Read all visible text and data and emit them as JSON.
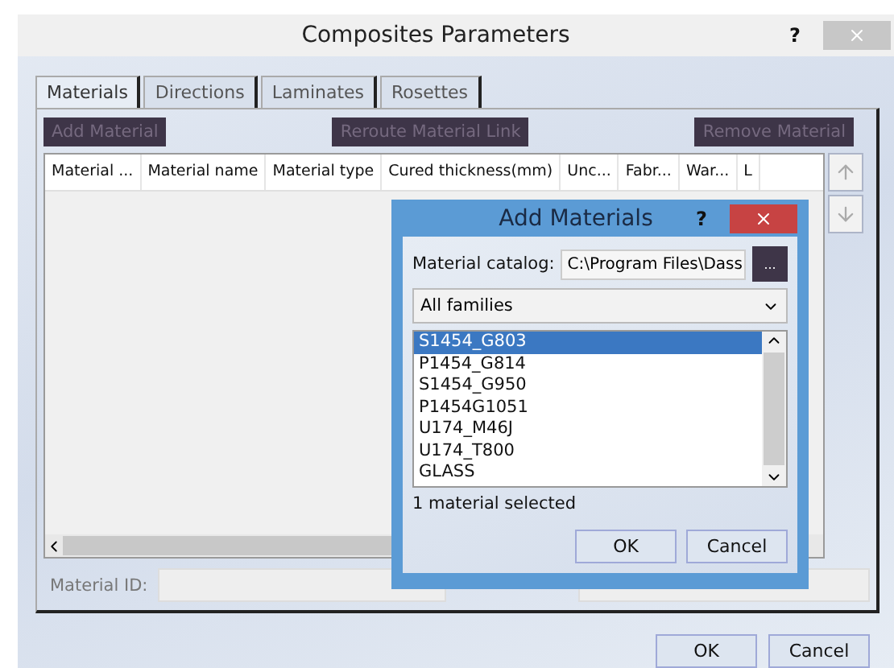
{
  "window": {
    "title": "Composites Parameters",
    "help": "?"
  },
  "tabs": [
    {
      "label": "Materials",
      "selected": true
    },
    {
      "label": "Directions",
      "selected": false
    },
    {
      "label": "Laminates",
      "selected": false
    },
    {
      "label": "Rosettes",
      "selected": false
    }
  ],
  "toolbar": [
    {
      "label": "Add Material",
      "disabled": true
    },
    {
      "label": "Reroute Material Link",
      "disabled": true
    },
    {
      "label": "Remove Material",
      "disabled": true
    }
  ],
  "table": {
    "columns": [
      "Material ...",
      "Material name",
      "Material type",
      "Cured thickness(mm)",
      "Unc...",
      "Fabr...",
      "War...",
      "L"
    ]
  },
  "material_id": {
    "label": "Material ID:"
  },
  "buttons": [
    "OK",
    "Cancel"
  ],
  "dialog": {
    "title": "Add Materials",
    "help": "?",
    "catalog_label": "Material catalog:",
    "catalog_value": "C:\\Program Files\\Dass",
    "browse": "...",
    "family": "All families",
    "items": [
      {
        "label": "S1454_G803",
        "selected": true
      },
      {
        "label": "P1454_G814",
        "selected": false
      },
      {
        "label": "S1454_G950",
        "selected": false
      },
      {
        "label": "P1454G1051",
        "selected": false
      },
      {
        "label": "U174_M46J",
        "selected": false
      },
      {
        "label": "U174_T800",
        "selected": false
      },
      {
        "label": "GLASS",
        "selected": false
      }
    ],
    "status": "1 material selected",
    "buttons": [
      "OK",
      "Cancel"
    ]
  }
}
